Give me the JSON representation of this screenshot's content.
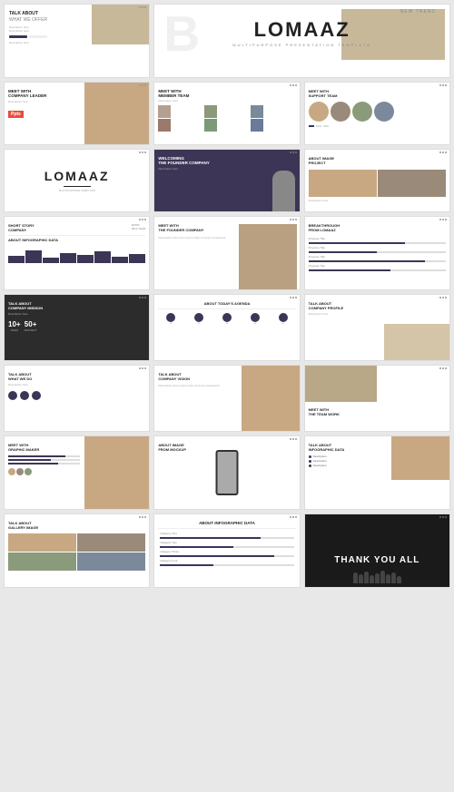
{
  "slides": {
    "hero": {
      "badge": "NEW TREND",
      "logo": "LOMAAZ",
      "tagline": "MULTIPURPOSE PRESENTATION TEMPLATE"
    },
    "slide1": {
      "title": "TALK ABOUT",
      "subtitle": "WHAT WE OFFER"
    },
    "slide2": {
      "title": "TALK ABOUT",
      "subtitle": "WHAT WE OFFER"
    },
    "slide3": {
      "title": "MEET WITH",
      "subtitle": "COMPANY LEADER"
    },
    "slide4": {
      "title": "MEET WITH",
      "subtitle": "MEMBER TEAM"
    },
    "slide5": {
      "title": "MEET WITH",
      "subtitle": "SUPPORT TEAM"
    },
    "slide6": {
      "logo": "LOMAAZ"
    },
    "slide7": {
      "title": "WELCOMING",
      "subtitle": "THE FOUNDER COMPANY"
    },
    "slide8": {
      "title": "ABOUT IMAGE",
      "subtitle": "PROJECT"
    },
    "slide9": {
      "title": "SHORT STORY",
      "subtitle": "COMPANY",
      "year": "FROM 2016 YEAR",
      "chart_label": "ABOUT INFOGRAPHIC DATA"
    },
    "slide10": {
      "title": "MEET WITH",
      "subtitle": "THE FOUNDER COMPANY"
    },
    "slide11": {
      "title": "BREAKTHROUGH",
      "subtitle": "FROM LOMAAZ"
    },
    "slide12": {
      "title": "TALK ABOUT",
      "subtitle": "COMPANY MISSION"
    },
    "slide13": {
      "title": "ABOUT TODAY'S AGENDA"
    },
    "slide14": {
      "title": "TALK ABOUT",
      "subtitle": "COMPANY PROFILE"
    },
    "slide15": {
      "title": "TALK ABOUT",
      "subtitle": "WHAT WE DO"
    },
    "slide16": {
      "title": "TALK ABOUT",
      "subtitle": "COMPANY VISION"
    },
    "slide17": {
      "title": "MEET WITH",
      "subtitle": "THE TEAM WORK"
    },
    "slide18": {
      "title": "ABOUT IMAGE",
      "subtitle": "FROM MOCKUP"
    },
    "slide19": {
      "title": "TALK ABOUT",
      "subtitle": "INFOGRAPHIC DATA"
    },
    "slide20": {
      "title": "MEET WITH",
      "subtitle": "GRAPHIC MAKER"
    },
    "slide21": {
      "title": "ABOUT INFOGRAPHIC DATA"
    },
    "slide22": {
      "title": "TALK ABOUT",
      "subtitle": "GALLERY IMAGE"
    },
    "slide23": {
      "title": "THANK YOU ALL"
    },
    "pptx": "Pptx"
  }
}
